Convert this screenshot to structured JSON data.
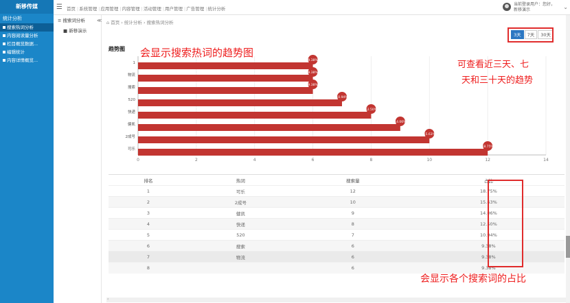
{
  "brand": "新移传媒",
  "sidebar": {
    "title": "统计分析",
    "items": [
      {
        "label": "搜索热词分析",
        "active": true
      },
      {
        "label": "内容阅读量分析",
        "active": false
      },
      {
        "label": "栏目概览数据...",
        "active": false
      },
      {
        "label": "编辑统计",
        "active": false
      },
      {
        "label": "内容详情概览...",
        "active": false
      }
    ]
  },
  "topnav": {
    "items": [
      "首页",
      "系统管理",
      "应用管理",
      "内容管理",
      "活动管理",
      "用户管理",
      "广告管理",
      "统计分析"
    ]
  },
  "user": {
    "line1": "当前登录用户：您好，",
    "line2": "新移演示"
  },
  "subpanel": {
    "title": "≡ 搜索词分析",
    "item": "■ 新移演示",
    "collapse": "≪"
  },
  "breadcrumb": "⌂ 首页 › 统计分析 › 搜索热词分析",
  "range": {
    "buttons": [
      "3天",
      "7天",
      "30天"
    ],
    "active": 0
  },
  "chart_title": "趋势图",
  "chart_data": {
    "type": "bar",
    "orientation": "horizontal",
    "categories": [
      "1",
      "物流",
      "搜索",
      "520",
      "快递",
      "健凯",
      "2成号",
      "可乐"
    ],
    "values": [
      6,
      6,
      6,
      7,
      8,
      9,
      10,
      12
    ],
    "labels": [
      "9.38%",
      "9.38%",
      "9.38%",
      "10.94%",
      "12.50%",
      "14.06%",
      "15.63%",
      "18.75%"
    ],
    "xlim": [
      0,
      14
    ],
    "xticks": [
      0,
      2,
      4,
      6,
      8,
      10,
      12,
      14
    ],
    "color": "#c23531"
  },
  "table": {
    "headers": [
      "排名",
      "热词",
      "搜索量",
      "占比"
    ],
    "rows": [
      [
        "1",
        "可乐",
        "12",
        "18.75%"
      ],
      [
        "2",
        "2成号",
        "10",
        "15.63%"
      ],
      [
        "3",
        "健凯",
        "9",
        "14.06%"
      ],
      [
        "4",
        "快递",
        "8",
        "12.50%"
      ],
      [
        "5",
        "520",
        "7",
        "10.94%"
      ],
      [
        "6",
        "搜索",
        "6",
        "9.38%"
      ],
      [
        "7",
        "物流",
        "6",
        "9.38%"
      ],
      [
        "8",
        "",
        "6",
        "9.38%"
      ]
    ]
  },
  "annotations": {
    "trend": "会显示搜索热词的趋势图",
    "range_line1": "可查看近三天、七",
    "range_line2": "天和三十天的趋势",
    "ratio": "会显示各个搜索词的占比"
  },
  "colors": {
    "sidebar": "#1b86c8",
    "bar": "#c23531",
    "annotation": "#ee1c1c",
    "active_button": "#2c77c2"
  }
}
